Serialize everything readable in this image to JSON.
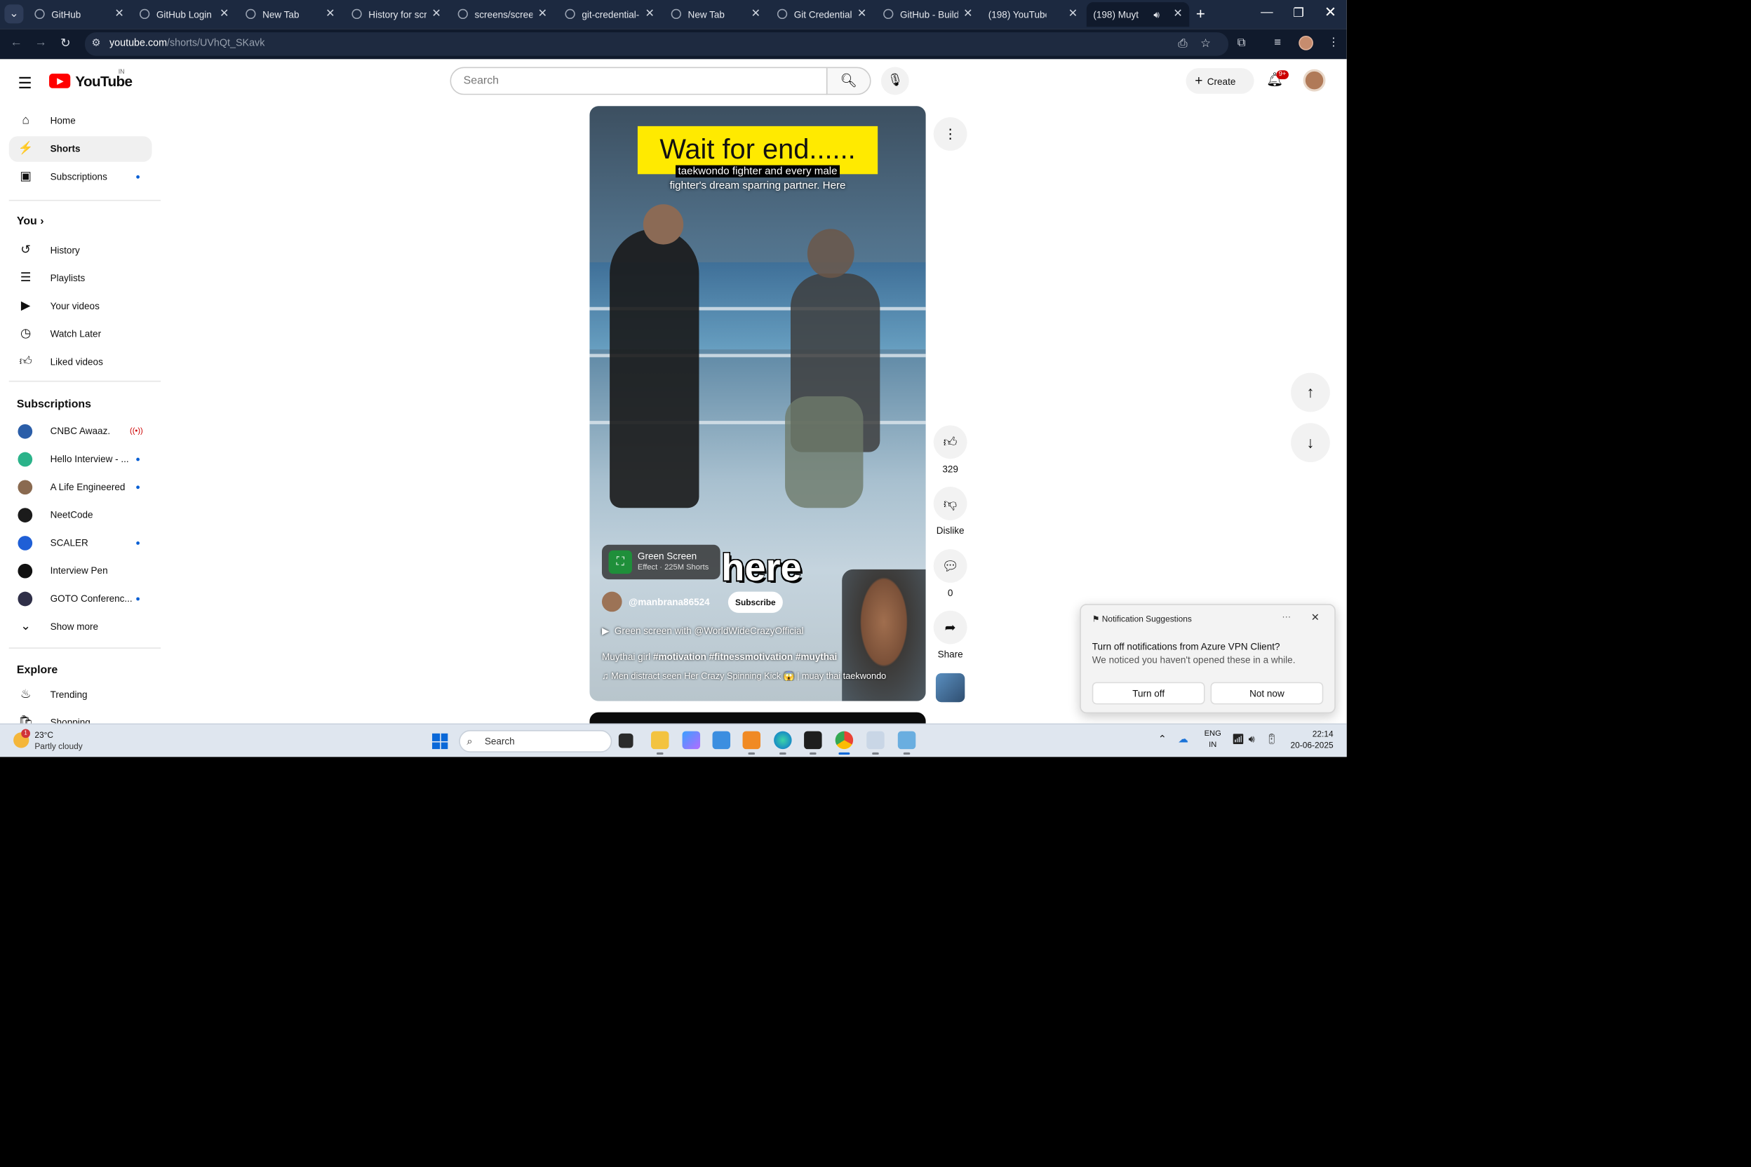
{
  "browser": {
    "tabs": [
      {
        "label": "GitHub",
        "icon": "github-icon"
      },
      {
        "label": "GitHub Login I",
        "icon": "github-icon"
      },
      {
        "label": "New Tab",
        "icon": "chrome-icon"
      },
      {
        "label": "History for scr",
        "icon": "github-icon"
      },
      {
        "label": "screens/screen",
        "icon": "github-icon"
      },
      {
        "label": "git-credential-",
        "icon": "github-icon"
      },
      {
        "label": "New Tab",
        "icon": "chrome-icon"
      },
      {
        "label": "Git Credential M",
        "icon": "web-icon"
      },
      {
        "label": "GitHub - Build",
        "icon": "github-icon"
      },
      {
        "label": "(198) YouTube",
        "icon": "youtube-icon"
      },
      {
        "label": "(198) Muyt",
        "icon": "youtube-icon"
      }
    ],
    "url_host": "youtube.com",
    "url_path": "/shorts/UVhQt_SKavk"
  },
  "youtube": {
    "logo_text": "YouTube",
    "country_code": "IN",
    "search_placeholder": "Search",
    "create_label": "Create",
    "notif_badge": "9+",
    "sidebar": {
      "main": [
        {
          "label": "Home",
          "icon": "home-icon"
        },
        {
          "label": "Shorts",
          "icon": "shorts-icon"
        },
        {
          "label": "Subscriptions",
          "icon": "subscriptions-icon"
        }
      ],
      "you_heading": "You",
      "you_items": [
        {
          "label": "History",
          "icon": "history-icon"
        },
        {
          "label": "Playlists",
          "icon": "playlists-icon"
        },
        {
          "label": "Your videos",
          "icon": "your-videos-icon"
        },
        {
          "label": "Watch Later",
          "icon": "watch-later-icon"
        },
        {
          "label": "Liked videos",
          "icon": "liked-videos-icon"
        }
      ],
      "subs_heading": "Subscriptions",
      "subs": [
        {
          "label": "CNBC Awaaz.",
          "color": "#2b5ea8"
        },
        {
          "label": "Hello Interview - ...",
          "color": "#2bb38a"
        },
        {
          "label": "A Life Engineered",
          "color": "#8a6a50"
        },
        {
          "label": "NeetCode",
          "color": "#1b1b1b"
        },
        {
          "label": "SCALER",
          "color": "#1f5fd6"
        },
        {
          "label": "Interview Pen",
          "color": "#111111"
        },
        {
          "label": "GOTO Conferenc...",
          "color": "#2f2f48"
        }
      ],
      "show_more": "Show more",
      "explore_heading": "Explore",
      "explore": [
        {
          "label": "Trending",
          "icon": "trending-icon"
        },
        {
          "label": "Shopping",
          "icon": "shopping-icon"
        }
      ]
    },
    "short": {
      "banner": "Wait for end......",
      "caption_line1": "taekwondo fighter and every male",
      "caption_line2": "fighter's dream sparring partner. Here",
      "overlay_word": "here",
      "effect_title": "Green Screen",
      "effect_sub": "Effect · 225M Shorts",
      "channel": "@manbrana86524",
      "subscribe": "Subscribe",
      "green_screen_line": "Green screen with @WorldWideCrazyOfficial",
      "desc_plain": "Muythai girl ",
      "desc_tags": "#motivation #fitnessmotivation #muythai",
      "music": "Men distract seen Her Crazy Spinning Kick 😱 | muay thai taekwondo"
    },
    "actions": {
      "likes": "329",
      "dislike_label": "Dislike",
      "comments": "0",
      "share_label": "Share"
    }
  },
  "notification": {
    "header": "Notification Suggestions",
    "title": "Turn off notifications from Azure VPN Client?",
    "body": "We noticed you haven't opened these in a while.",
    "turn_off": "Turn off",
    "not_now": "Not now"
  },
  "taskbar": {
    "temp": "23°C",
    "weather": "Partly cloudy",
    "weather_badge": "1",
    "search": "Search",
    "lang1": "ENG",
    "lang2": "IN",
    "time": "22:14",
    "date": "20-06-2025"
  }
}
